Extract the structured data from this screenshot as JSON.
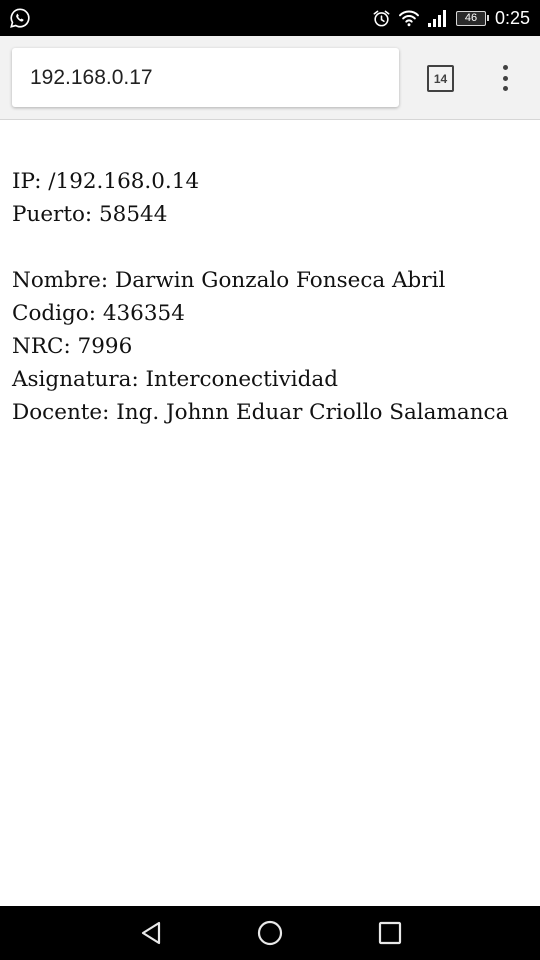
{
  "status_bar": {
    "left_icon": "whatsapp-icon",
    "icons": [
      "alarm-icon",
      "wifi-icon",
      "signal-icon"
    ],
    "battery_level": "46",
    "time": "0:25"
  },
  "browser": {
    "url": "192.168.0.17",
    "tab_count": "14",
    "menu_icon": "more-vert-icon"
  },
  "page": {
    "ip": "IP: /192.168.0.14",
    "port": "Puerto: 58544",
    "name": "Nombre: Darwin Gonzalo Fonseca Abril",
    "code": "Codigo: 436354",
    "nrc": "NRC: 7996",
    "subject": "Asignatura: Interconectividad",
    "teacher": "Docente: Ing. Johnn Eduar Criollo Salamanca"
  },
  "nav_bar": {
    "buttons": [
      "back-icon",
      "home-icon",
      "recents-icon"
    ]
  }
}
